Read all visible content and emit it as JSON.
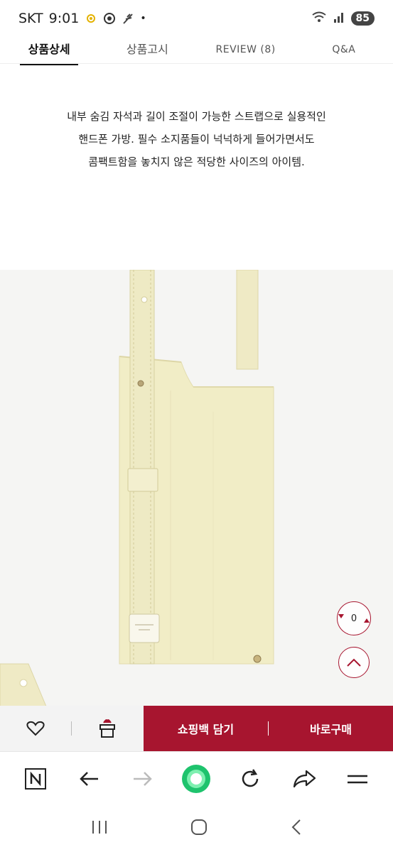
{
  "status": {
    "carrier": "SKT",
    "time": "9:01",
    "dot": "•",
    "battery": "85"
  },
  "tabs": [
    {
      "label": "상품상세"
    },
    {
      "label": "상품고시"
    },
    {
      "label": "REVIEW (8)"
    },
    {
      "label": "Q&A"
    }
  ],
  "description": {
    "line1": "내부 숨김 자석과 길이 조절이 가능한 스트랩으로 실용적인",
    "line2": "핸드폰 가방. 필수 소지품들이 넉넉하게 들어가면서도",
    "line3": "콤팩트함을 놓치지 않은 적당한 사이즈의 아이템."
  },
  "fab": {
    "count": "0"
  },
  "bottom_bar": {
    "cart_label": "쇼핑백 담기",
    "buy_label": "바로구매",
    "divider": "|"
  },
  "colors": {
    "brand": "#a7152f",
    "bag": "#f1edc6",
    "browser_green": "#1ec36d"
  },
  "icons": [
    "heart-icon",
    "gift-icon",
    "n-logo-icon",
    "back-icon",
    "forward-icon",
    "home-dot-icon",
    "reload-icon",
    "share-icon",
    "menu-icon"
  ]
}
